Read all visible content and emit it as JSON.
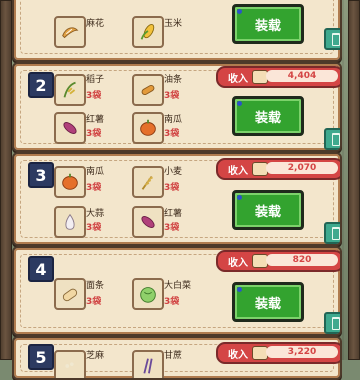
{
  "ui": {
    "income_label": "收入",
    "load_button": "装载",
    "colors": {
      "income_pill": "#d44545",
      "load_button": "#33a32f",
      "crate_bg": "#f3e6cc",
      "number_badge": "#2c3a61",
      "trash": "#3ea98e"
    }
  },
  "crates": [
    {
      "number": "1",
      "income": "",
      "items": [
        {
          "name": "麻花",
          "qty": "",
          "icon": "twisted-dough-icon"
        },
        {
          "name": "玉米",
          "qty": "",
          "icon": "corn-icon"
        }
      ]
    },
    {
      "number": "2",
      "income": "4,404",
      "items": [
        {
          "name": "稻子",
          "qty": "3袋",
          "icon": "rice-plant-icon"
        },
        {
          "name": "油条",
          "qty": "3袋",
          "icon": "fried-dough-icon"
        },
        {
          "name": "红薯",
          "qty": "3袋",
          "icon": "sweet-potato-icon"
        },
        {
          "name": "南瓜",
          "qty": "3袋",
          "icon": "pumpkin-icon"
        }
      ]
    },
    {
      "number": "3",
      "income": "2,070",
      "items": [
        {
          "name": "南瓜",
          "qty": "3袋",
          "icon": "pumpkin-icon"
        },
        {
          "name": "小麦",
          "qty": "3袋",
          "icon": "wheat-icon"
        },
        {
          "name": "大蒜",
          "qty": "3袋",
          "icon": "garlic-icon"
        },
        {
          "name": "红薯",
          "qty": "3袋",
          "icon": "sweet-potato-icon"
        }
      ]
    },
    {
      "number": "4",
      "income": "820",
      "items": [
        {
          "name": "面条",
          "qty": "3袋",
          "icon": "bread-icon"
        },
        {
          "name": "大白菜",
          "qty": "3袋",
          "icon": "cabbage-icon"
        }
      ]
    },
    {
      "number": "5",
      "income": "3,220",
      "items": [
        {
          "name": "芝麻",
          "qty": "",
          "icon": "sesame-icon"
        },
        {
          "name": "甘蔗",
          "qty": "",
          "icon": "sugarcane-icon"
        }
      ]
    }
  ]
}
